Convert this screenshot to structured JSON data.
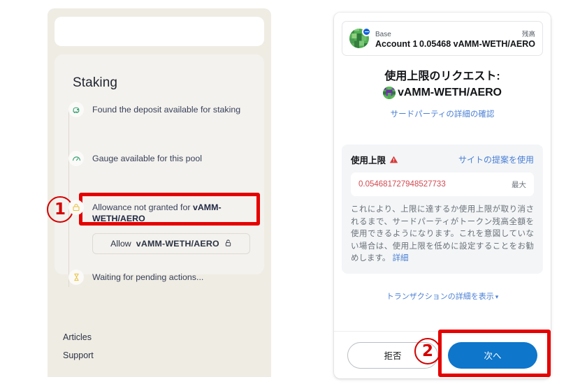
{
  "dapp": {
    "card_title": "Staking",
    "steps": [
      {
        "icon": "deposit-icon",
        "text": "Found the deposit available for staking",
        "bold": ""
      },
      {
        "icon": "gauge-icon",
        "text": "Gauge available for this pool",
        "bold": ""
      },
      {
        "icon": "lock-icon",
        "text": "Allowance not granted for ",
        "bold": "vAMM-WETH/AERO"
      },
      {
        "icon": "hourglass-icon",
        "text": "Waiting for pending actions...",
        "bold": ""
      }
    ],
    "allow_button": {
      "prefix": "Allow",
      "token": "vAMM-WETH/AERO",
      "icon": "unlock-icon"
    },
    "links": [
      {
        "label": "Articles"
      },
      {
        "label": "Support"
      }
    ]
  },
  "wallet": {
    "account": {
      "network": "Base",
      "name": "Account 1",
      "balance_label": "残高",
      "balance_value": "0.05468 vAMM-WETH/AERO",
      "avatar_icon": "account-identicon",
      "network_badge_icon": "network-badge-icon"
    },
    "request_title": "使用上限のリクエスト:",
    "token_name": "vAMM-WETH/AERO",
    "token_icon": "token-identicon",
    "third_party_link": "サードパーティの詳細の確認",
    "spending_cap": {
      "label": "使用上限",
      "warning_icon": "warning-triangle-icon",
      "use_site_suggestion": "サイトの提案を使用",
      "input_value": "0.054681727948527733",
      "max_label": "最大",
      "description": "これにより、上限に達するか使用上限が取り消されるまで、サードパーティがトークン残高全額を使用できるようになります。これを意図していない場合は、使用上限を低めに設定することをお勧めします。",
      "details_link": "詳細"
    },
    "transaction_details_toggle": "トランザクションの詳細を表示",
    "transaction_details_chevron": "chevron-down-icon",
    "footer": {
      "reject_label": "拒否",
      "next_label": "次へ"
    }
  },
  "annotations": [
    {
      "badge": "1",
      "target": "allow-token-button"
    },
    {
      "badge": "2",
      "target": "next-button"
    }
  ],
  "colors": {
    "accent_blue": "#0e76cb",
    "link_blue": "#4a7fd4",
    "annotation_red": "#e60000",
    "warning_red": "#d04a52",
    "dapp_bg": "#efece4",
    "card_bg": "#f4f2ee",
    "cap_bg": "#f3f5f7"
  }
}
